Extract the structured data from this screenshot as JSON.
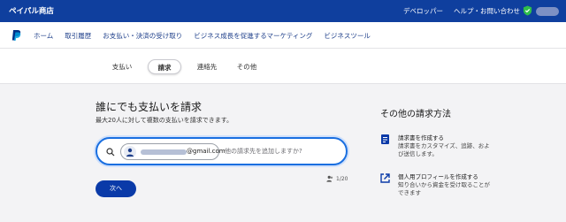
{
  "topbar": {
    "brand": "ペイパル商店",
    "links": [
      "デベロッパー",
      "ヘルプ・お問い合わせ"
    ]
  },
  "mainnav": {
    "items": [
      "ホーム",
      "取引履歴",
      "お支払い・決済の受け取り",
      "ビジネス成長を促進するマーケティング",
      "ビジネスツール"
    ]
  },
  "subtabs": {
    "items": [
      "支払い",
      "請求",
      "連絡先",
      "その他"
    ],
    "active_index": 1
  },
  "request": {
    "title": "誰にでも支払いを請求",
    "subtitle": "最大20人に対して複数の支払いを請求できます。",
    "chip_domain": "@gmail.com",
    "placeholder": "他の請求先を追加しますか?",
    "counter": "1/20",
    "next_label": "次へ"
  },
  "side": {
    "title": "その他の請求方法",
    "items": [
      {
        "icon": "invoice-icon",
        "title": "請求書を作成する",
        "desc": "請求書をカスタマイズ、追跡、および送信します。"
      },
      {
        "icon": "external-link-icon",
        "title": "個人用プロフィールを作成する",
        "desc": "知り合いから資金を受け取ることができます"
      }
    ]
  },
  "colors": {
    "topbar_bg": "#0f3f9e",
    "accent": "#1a6fe0",
    "button": "#0a3aa8",
    "nav_text": "#1d3e8a"
  }
}
